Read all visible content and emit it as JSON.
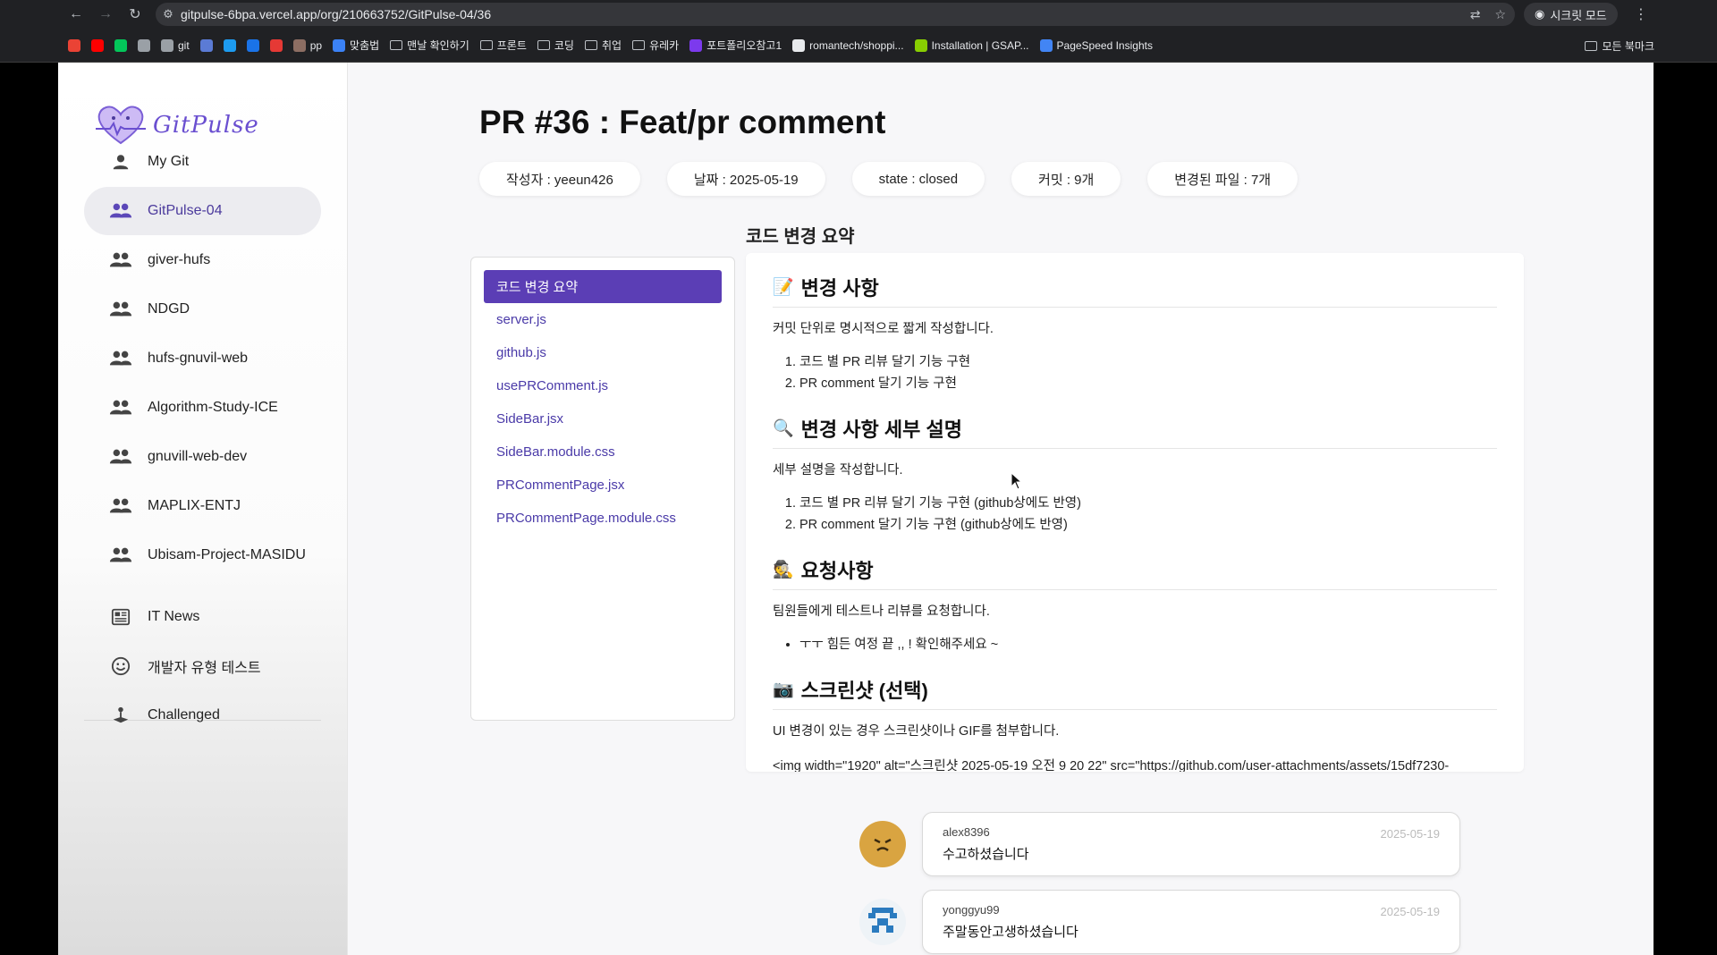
{
  "browser": {
    "url": "gitpulse-6bpa.vercel.app/org/210663752/GitPulse-04/36",
    "incognito_label": "시크릿 모드",
    "bookmarks": [
      {
        "label": "",
        "icon": "gmail-icon",
        "color": "#ea4335"
      },
      {
        "label": "",
        "icon": "youtube-icon",
        "color": "#ff0000"
      },
      {
        "label": "",
        "icon": "naver-icon",
        "color": "#03c75a"
      },
      {
        "label": "",
        "icon": "github-icon",
        "color": "#9aa0a6"
      },
      {
        "label": "git",
        "icon": "github-icon",
        "color": "#9aa0a6"
      },
      {
        "label": "",
        "icon": "code-icon",
        "color": "#5b7bd5"
      },
      {
        "label": "",
        "icon": "bolt-icon",
        "color": "#1d9bf0"
      },
      {
        "label": "",
        "icon": "m-icon",
        "color": "#1a73e8"
      },
      {
        "label": "",
        "icon": "heart-icon",
        "color": "#e53935"
      },
      {
        "label": "pp",
        "icon": "avatar-icon",
        "color": "#8d6e63"
      },
      {
        "label": "맞춤법",
        "icon": "spell-icon",
        "color": "#3b82f6"
      },
      {
        "label": "맨날 확인하기",
        "icon": "folder-icon",
        "color": ""
      },
      {
        "label": "프론트",
        "icon": "folder-icon",
        "color": ""
      },
      {
        "label": "코딩",
        "icon": "folder-icon",
        "color": ""
      },
      {
        "label": "취업",
        "icon": "folder-icon",
        "color": ""
      },
      {
        "label": "유레카",
        "icon": "folder-icon",
        "color": ""
      },
      {
        "label": "포트폴리오참고1",
        "icon": "m-logo-icon",
        "color": "#7c3aed"
      },
      {
        "label": "romantech/shoppi...",
        "icon": "github-icon",
        "color": "#e8eaed"
      },
      {
        "label": "Installation | GSAP...",
        "icon": "gsap-icon",
        "color": "#88ce02"
      },
      {
        "label": "PageSpeed Insights",
        "icon": "pagespeed-icon",
        "color": "#4285f4"
      }
    ],
    "all_bookmarks_label": "모든 북마크"
  },
  "sidebar": {
    "logo_text": "GitPulse",
    "items": [
      {
        "label": "My Git",
        "icon": "person-icon"
      },
      {
        "label": "GitPulse-04",
        "icon": "group-icon",
        "active": true
      },
      {
        "label": "giver-hufs",
        "icon": "group-icon"
      },
      {
        "label": "NDGD",
        "icon": "group-icon"
      },
      {
        "label": "hufs-gnuvil-web",
        "icon": "group-icon"
      },
      {
        "label": "Algorithm-Study-ICE",
        "icon": "group-icon"
      },
      {
        "label": "gnuvill-web-dev",
        "icon": "group-icon"
      },
      {
        "label": "MAPLIX-ENTJ",
        "icon": "group-icon"
      },
      {
        "label": "Ubisam-Project-MASIDU",
        "icon": "group-icon"
      }
    ],
    "bottom_items": [
      {
        "label": "IT News",
        "icon": "newspaper-icon"
      },
      {
        "label": "개발자 유형 테스트",
        "icon": "smile-icon"
      },
      {
        "label": "Challenged",
        "icon": "joystick-icon"
      }
    ]
  },
  "pr": {
    "title": "PR #36 : Feat/pr comment",
    "meta": [
      "작성자 : yeeun426",
      "날짜 : 2025-05-19",
      "state : closed",
      "커밋 : 9개",
      "변경된 파일 : 7개"
    ],
    "section_title": "코드 변경 요약",
    "files": [
      "코드 변경 요약",
      "server.js",
      "github.js",
      "usePRComment.js",
      "SideBar.jsx",
      "SideBar.module.css",
      "PRCommentPage.jsx",
      "PRCommentPage.module.css"
    ]
  },
  "summary": {
    "changes_title": "변경 사항",
    "changes_emoji": "📝",
    "changes_desc": "커밋 단위로 명시적으로 짧게 작성합니다.",
    "changes_list": [
      "코드 별 PR 리뷰 달기 기능 구현",
      "PR comment 달기 기능 구현"
    ],
    "detail_title": "변경 사항 세부 설명",
    "detail_emoji": "🔍",
    "detail_desc": "세부 설명을 작성합니다.",
    "detail_list": [
      "코드 별 PR 리뷰 달기 기능 구현 (github상에도 반영)",
      "PR comment 달기 기능 구현 (github상에도 반영)"
    ],
    "request_title": "요청사항",
    "request_emoji": "🕵",
    "request_desc": "팀원들에게 테스트나 리뷰를 요청합니다.",
    "request_list": [
      "ㅜㅜ 힘든 여정 끝 ,, ! 확인해주세요 ~"
    ],
    "screenshot_title": "스크린샷 (선택)",
    "screenshot_emoji": "📷",
    "screenshot_desc": "UI 변경이 있는 경우 스크린샷이나 GIF를 첨부합니다.",
    "screenshot_code": "<img width=\"1920\" alt=\"스크린샷 2025-05-19 오전 9 20 22\" src=\"https://github.com/user-attachments/assets/15df7230-"
  },
  "comments": [
    {
      "user": "alex8396",
      "date": "2025-05-19",
      "text": "수고하셨습니다"
    },
    {
      "user": "yonggyu99",
      "date": "2025-05-19",
      "text": "주말동안고생하셨습니다"
    }
  ],
  "colors": {
    "accent": "#5b3eb5",
    "link": "#4a3aa8"
  }
}
